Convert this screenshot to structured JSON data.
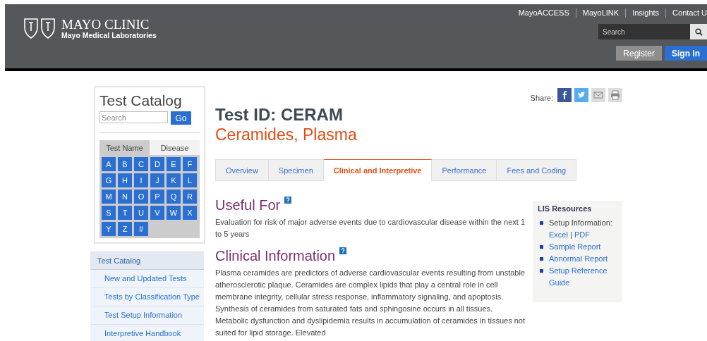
{
  "header": {
    "logo_title": "MAYO CLINIC",
    "logo_subtitle": "Mayo Medical Laboratories",
    "top_links": [
      "MayoACCESS",
      "MayoLINK",
      "Insights",
      "Contact U"
    ],
    "search": {
      "placeholder": "Search"
    },
    "buttons": [
      {
        "label": "Register",
        "kind": "secondary"
      },
      {
        "label": "Sign In",
        "kind": "primary"
      }
    ]
  },
  "sidebar": {
    "title": "Test Catalog",
    "search": {
      "placeholder": "Search"
    },
    "go_button": "Go",
    "index_tabs": [
      {
        "label": "Test Name",
        "selected": true
      },
      {
        "label": "Disease",
        "selected": false
      }
    ],
    "letters": [
      "A",
      "B",
      "C",
      "D",
      "E",
      "F",
      "G",
      "H",
      "I",
      "J",
      "K",
      "L",
      "M",
      "N",
      "O",
      "P",
      "Q",
      "R",
      "S",
      "T",
      "U",
      "V",
      "W",
      "X",
      "Y",
      "Z",
      "#"
    ],
    "nav": {
      "title": "Test Catalog",
      "items": [
        "New and Updated Tests",
        "Tests by Classification Type",
        "Test Setup Information",
        "Interpretive Handbook"
      ]
    }
  },
  "main": {
    "share_label": "Share:",
    "test_id": "Test ID: CERAM",
    "test_name": "Ceramides, Plasma",
    "tabs": [
      {
        "label": "Overview",
        "selected": false
      },
      {
        "label": "Specimen",
        "selected": false
      },
      {
        "label": "Clinical and Interpretive",
        "selected": true
      },
      {
        "label": "Performance",
        "selected": false
      },
      {
        "label": "Fees and Coding",
        "selected": false
      }
    ],
    "sections": [
      {
        "heading": "Useful For",
        "body": "Evaluation for risk of major adverse events due to cardiovascular disease within the next 1 to 5 years"
      },
      {
        "heading": "Clinical Information",
        "body": "Plasma ceramides are predictors of adverse cardiovascular events resulting from unstable atherosclerotic plaque. Ceramides are complex lipids that play a central role in cell membrane integrity, cellular stress response, inflammatory signaling, and apoptosis. Synthesis of ceramides from saturated fats and sphingosine occurs in all tissues. Metabolic dysfunction and dyslipidemia results in accumulation of ceramides in tissues not suited for lipid storage. Elevated"
      }
    ],
    "lis_resources": {
      "title": "LIS Resources",
      "items": [
        {
          "kind": "files",
          "label": "Setup Information:",
          "links": [
            "Excel",
            "PDF"
          ],
          "separator": "|"
        },
        {
          "kind": "link",
          "label": "Sample Report"
        },
        {
          "kind": "link",
          "label": "Abnormal Report"
        },
        {
          "kind": "link",
          "label": "Setup Reference Guide"
        }
      ]
    }
  }
}
